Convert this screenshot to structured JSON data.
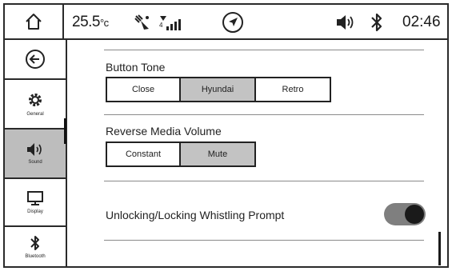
{
  "status_bar": {
    "temperature": "25.5",
    "temperature_unit": "°c",
    "time": "02:46"
  },
  "sidebar": {
    "items": [
      {
        "label": "General"
      },
      {
        "label": "Sound"
      },
      {
        "label": "Display"
      },
      {
        "label": "Bluetooth"
      }
    ],
    "active": "Sound"
  },
  "settings": {
    "button_tone": {
      "title": "Button Tone",
      "options": [
        "Close",
        "Hyundai",
        "Retro"
      ],
      "selected": "Hyundai"
    },
    "reverse_media_volume": {
      "title": "Reverse Media Volume",
      "options": [
        "Constant",
        "Mute"
      ],
      "selected": "Mute"
    },
    "whistling_prompt": {
      "title": "Unlocking/Locking Whistling Prompt",
      "enabled": true
    }
  }
}
